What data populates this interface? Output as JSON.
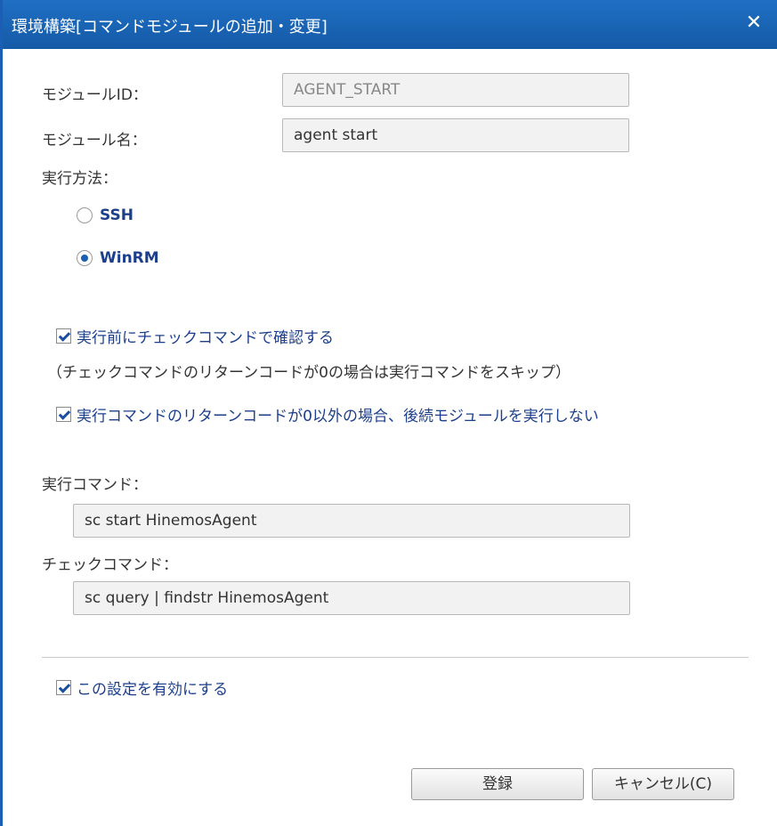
{
  "window": {
    "title": "環境構築[コマンドモジュールの追加・変更]",
    "close_symbol": "✕"
  },
  "form": {
    "module_id_label": "モジュールID：",
    "module_id_value": "AGENT_START",
    "module_name_label": "モジュール名：",
    "module_name_value": "agent start",
    "exec_method_label": "実行方法：",
    "exec_method_options": [
      {
        "label": "SSH",
        "selected": false
      },
      {
        "label": "WinRM",
        "selected": true
      }
    ],
    "precheck_checkbox_label": "実行前にチェックコマンドで確認する",
    "precheck_checked": true,
    "precheck_note": "（チェックコマンドのリターンコードが0の場合は実行コマンドをスキップ）",
    "stop_on_error_checkbox_label": "実行コマンドのリターンコードが0以外の場合、後続モジュールを実行しない",
    "stop_on_error_checked": true,
    "exec_command_label": "実行コマンド：",
    "exec_command_value": "sc start HinemosAgent",
    "check_command_label": "チェックコマンド：",
    "check_command_value": "sc query | findstr HinemosAgent",
    "enable_checkbox_label": "この設定を有効にする",
    "enable_checked": true
  },
  "buttons": {
    "register_label": "登録",
    "cancel_label": "キャンセル(C)"
  },
  "colors": {
    "titlebar": "#1a5fb4",
    "accent_text": "#1c3f8c"
  }
}
